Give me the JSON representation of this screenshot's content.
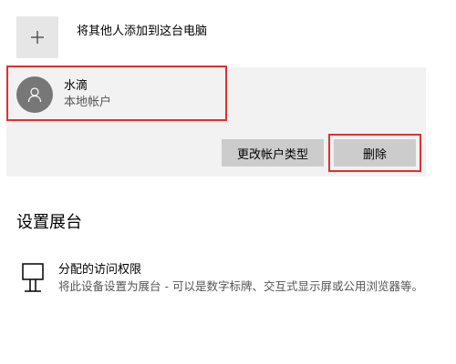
{
  "add_user": {
    "label": "将其他人添加到这台电脑",
    "icon": "plus-icon"
  },
  "account": {
    "name": "水滴",
    "type": "本地帐户",
    "avatar_icon": "person-icon",
    "change_type_button": "更改帐户类型",
    "delete_button": "删除"
  },
  "kiosk": {
    "heading": "设置展台",
    "item_title": "分配的访问权限",
    "item_desc": "将此设备设置为展台 - 可以是数字标牌、交互式显示屏或公用浏览器等。",
    "icon": "kiosk-icon"
  },
  "colors": {
    "highlight": "#e03030",
    "panel_bg": "#f2f2f2",
    "button_bg": "#cccccc",
    "avatar_bg": "#777777",
    "secondary_text": "#555555"
  }
}
